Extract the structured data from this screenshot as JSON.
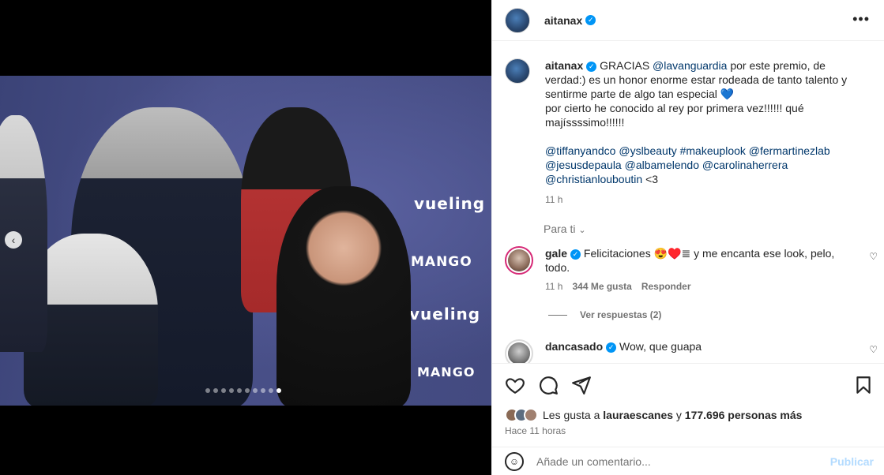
{
  "post": {
    "author": "aitanax",
    "more_icon": "more-horizontal-icon",
    "caption_lines": {
      "c1": "GRACIAS",
      "mention1": "@lavanguardia",
      "c2": "por este premio, de verdad:) es un honor enorme estar rodeada de tanto talento y sentirme parte de algo tan especial",
      "heart": "💙",
      "c3": "por cierto he conocido al rey por primera vez!!!!!! qué majíssssimo!!!!!!"
    },
    "tags": {
      "t1": "@tiffanyandco",
      "t2": "@yslbeauty",
      "t3": "#makeuplook",
      "t4": "@fermartinezlab",
      "t5": "@jesusdepaula",
      "t6": "@albamelendo",
      "t7": "@carolinaherrera",
      "t8": "@christianlouboutin",
      "t9": "<3"
    },
    "caption_time": "11 h",
    "sort_label": "Para ti",
    "photo": {
      "brand1": "vueling",
      "brand2": "MANGO",
      "brand3": "vueling",
      "brand4": "MANGO",
      "carousel_count": 10,
      "carousel_active": 10
    }
  },
  "comments": [
    {
      "user": "gale",
      "text": "Felicitaciones 😍♥️≣ y me encanta ese look, pelo, todo.",
      "time": "11 h",
      "likes": "344 Me gusta",
      "reply": "Responder",
      "view_replies": "Ver respuestas (2)"
    },
    {
      "user": "dancasado",
      "text": "Wow, que guapa"
    }
  ],
  "actions": {
    "liked_by_prefix": "Les gusta a",
    "liked_by_user": "lauraescanes",
    "liked_by_join": "y",
    "liked_by_count": "177.696 personas más",
    "timestamp": "Hace 11 horas"
  },
  "composer": {
    "placeholder": "Añade un comentario...",
    "publish": "Publicar"
  },
  "colors": {
    "link": "#00376b",
    "verified": "#0095f6",
    "publish_disabled": "#b3dbff"
  }
}
